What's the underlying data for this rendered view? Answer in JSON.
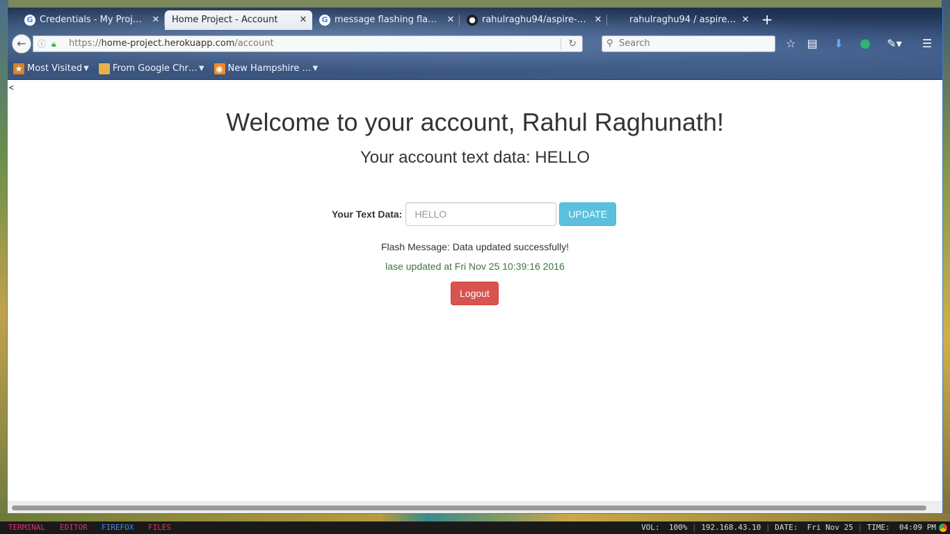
{
  "browser": {
    "tabs": [
      {
        "label": "Credentials - My Proj…",
        "icon": "google-icon",
        "active": false
      },
      {
        "label": "Home Project - Account",
        "icon": "",
        "active": true
      },
      {
        "label": "message flashing fla…",
        "icon": "google-icon",
        "active": false
      },
      {
        "label": "rahulraghu94/aspire-…",
        "icon": "github-icon",
        "active": false
      },
      {
        "label": "rahulraghu94 / aspire…",
        "icon": "",
        "active": false
      }
    ],
    "new_tab_label": "+",
    "url": {
      "scheme": "https://",
      "host": "home-project.herokuapp.com",
      "path": "/account"
    },
    "search_placeholder": "Search",
    "bookmarks": [
      {
        "label": "Most Visited",
        "icon": "most-visited-icon"
      },
      {
        "label": "From Google Chr…",
        "icon": "folder-icon"
      },
      {
        "label": "New Hampshire …",
        "icon": "rss-icon"
      }
    ]
  },
  "page": {
    "back_link": "<",
    "welcome": "Welcome to your account, Rahul Raghunath!",
    "account_text": "Your account text data: HELLO",
    "form": {
      "label": "Your Text Data:",
      "placeholder": "HELLO",
      "update_label": "UPDATE"
    },
    "flash_message": "Flash Message: Data updated successfully!",
    "last_updated": "lase updated at Fri Nov 25 10:39:16 2016",
    "logout_label": "Logout"
  },
  "statusbar": {
    "workspaces": [
      "TERMINAL",
      "EDITOR",
      "FIREFOX",
      "FILES"
    ],
    "vol_label": "VOL:",
    "vol": "100%",
    "ip": "192.168.43.10",
    "date_label": "DATE:",
    "date": "Fri Nov 25",
    "time_label": "TIME:",
    "time": "04:09 PM"
  },
  "colors": {
    "update_button": "#5bc0de",
    "logout_button": "#d9534f",
    "success_text": "#3c763d",
    "window_border": "#4a7ab8"
  }
}
